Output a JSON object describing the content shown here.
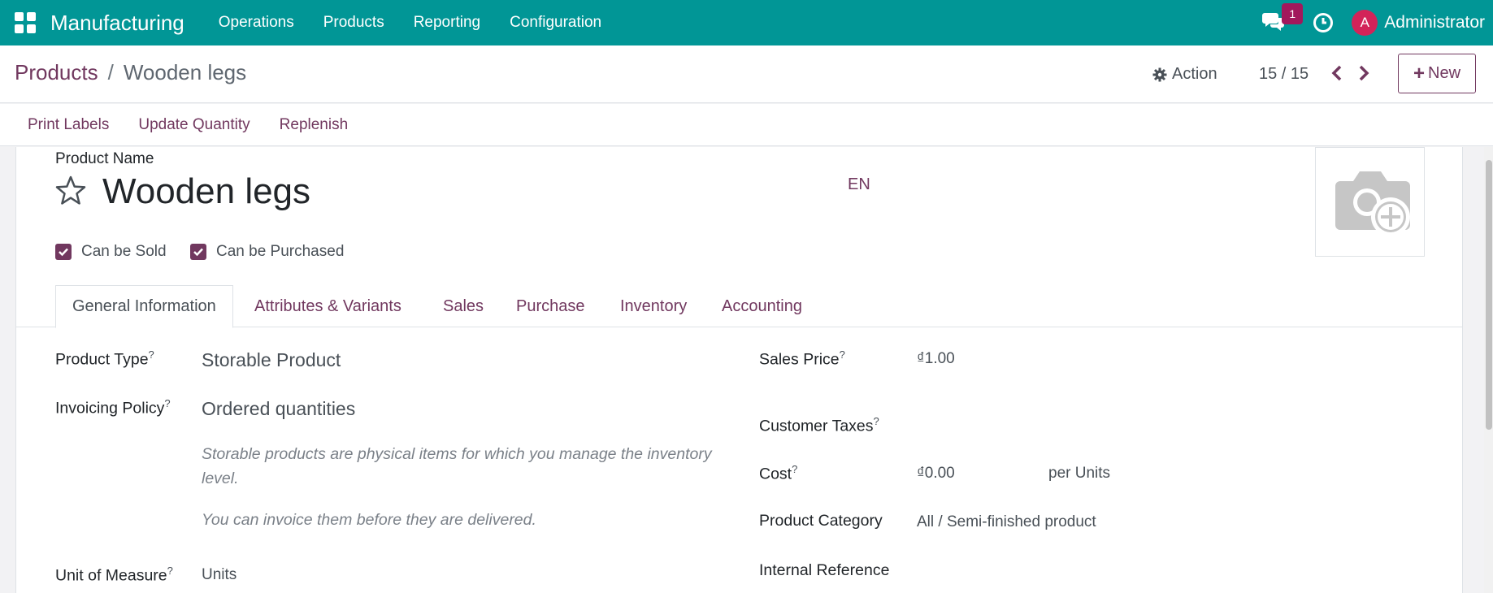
{
  "navbar": {
    "app_name": "Manufacturing",
    "menu": [
      "Operations",
      "Products",
      "Reporting",
      "Configuration"
    ],
    "chat_count": "1",
    "avatar_initial": "A",
    "username": "Administrator"
  },
  "control": {
    "breadcrumb_parent": "Products",
    "breadcrumb_sep": "/",
    "breadcrumb_current": "Wooden legs",
    "action_label": "Action",
    "pager": "15 / 15",
    "new_label": "New"
  },
  "statusbar": {
    "buttons": [
      "Print Labels",
      "Update Quantity",
      "Replenish"
    ]
  },
  "product": {
    "name_label": "Product Name",
    "name": "Wooden legs",
    "lang": "EN",
    "can_be_sold": "Can be Sold",
    "can_be_purchased": "Can be Purchased"
  },
  "tabs": [
    "General Information",
    "Attributes & Variants",
    "Sales",
    "Purchase",
    "Inventory",
    "Accounting"
  ],
  "fields": {
    "product_type_label": "Product Type",
    "product_type": "Storable Product",
    "invoicing_policy_label": "Invoicing Policy",
    "invoicing_policy": "Ordered quantities",
    "help_storable": "Storable products are physical items for which you manage the inventory level.",
    "help_invoice": "You can invoice them before they are delivered.",
    "uom_label": "Unit of Measure",
    "uom": "Units",
    "sales_price_label": "Sales Price",
    "sales_price": "₫1.00",
    "customer_taxes_label": "Customer Taxes",
    "cost_label": "Cost",
    "cost": "₫0.00",
    "cost_unit": "per Units",
    "category_label": "Product Category",
    "category": "All / Semi-finished product",
    "internal_ref_label": "Internal Reference",
    "help_mark": "?"
  },
  "colors": {
    "navbar": "#019696",
    "accent": "#71385f",
    "badge": "#a2185c",
    "avatar": "#d32359"
  }
}
